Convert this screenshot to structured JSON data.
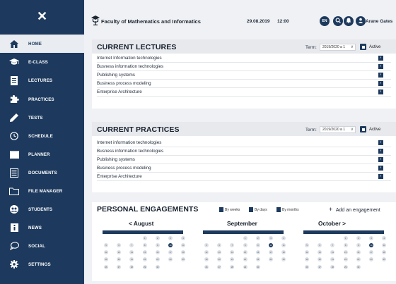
{
  "sidebar": {
    "close_symbol": "✕",
    "items": [
      {
        "label": "HOME",
        "icon": "home-icon",
        "active": true
      },
      {
        "label": "E-CLASS",
        "icon": "graduation-cap-icon"
      },
      {
        "label": "LECTURES",
        "icon": "document-list-icon"
      },
      {
        "label": "PRACTICES",
        "icon": "puzzle-icon"
      },
      {
        "label": "TESTS",
        "icon": "pencil-icon"
      },
      {
        "label": "SCHEDULE",
        "icon": "clock-icon"
      },
      {
        "label": "PLANNER",
        "icon": "planner-icon"
      },
      {
        "label": "DOCUMENTS",
        "icon": "documents-icon"
      },
      {
        "label": "FILE MANAGER",
        "icon": "folder-icon"
      },
      {
        "label": "STUDENTS",
        "icon": "students-icon"
      },
      {
        "label": "NEWS",
        "icon": "info-icon"
      },
      {
        "label": "SOCIAL",
        "icon": "chat-bubble-icon"
      },
      {
        "label": "SETTINGS",
        "icon": "gear-icon"
      }
    ]
  },
  "header": {
    "faculty": "Faculty of Mathematics and Informatics",
    "date": "29.08.2019",
    "time": "12:00",
    "language": "EN",
    "user_name": "Arane Gates"
  },
  "lectures": {
    "title": "CURRENT LECTURES",
    "term_label": "Term:",
    "term_value": "2019/2020 a 1",
    "active_label": "Active",
    "rows": [
      "Internet Information technologies",
      "Busness information technologies",
      "Publishing systems",
      "Business process modeling",
      "Enterprise Architecture"
    ]
  },
  "practices": {
    "title": "CURRENT PRACTICES",
    "term_label": "Term:",
    "term_value": "2019/2020 a 1",
    "active_label": "Active",
    "rows": [
      "Internet information technologies",
      "Busness information technologies",
      "Publishing systems",
      "Business process modeling",
      "Enterprise Architecture"
    ]
  },
  "engagements": {
    "title": "PERSONAL ENGAGEMENTS",
    "filters": [
      "By weeks",
      "By days",
      "By months"
    ],
    "add_label": "Add an engagement",
    "months": [
      {
        "name": "August",
        "prev_arrow": "<",
        "next_arrow": "",
        "current_day": "10"
      },
      {
        "name": "September",
        "prev_arrow": "",
        "next_arrow": "",
        "current_day": "10"
      },
      {
        "name": "October",
        "prev_arrow": "",
        "next_arrow": ">",
        "current_day": "10"
      }
    ],
    "day_rows": [
      [
        "",
        "",
        "",
        "1",
        "2",
        "3",
        "4"
      ],
      [
        "5",
        "6",
        "7",
        "8",
        "9",
        "10",
        "11"
      ],
      [
        "12",
        "13",
        "14",
        "15",
        "16",
        "17",
        "18"
      ],
      [
        "19",
        "20",
        "21",
        "22",
        "23",
        "24",
        "25"
      ],
      [
        "26",
        "27",
        "28",
        "29",
        "30",
        "",
        ""
      ]
    ]
  },
  "colors": {
    "navy": "#1d3a5e",
    "background": "#f0f1f4"
  }
}
